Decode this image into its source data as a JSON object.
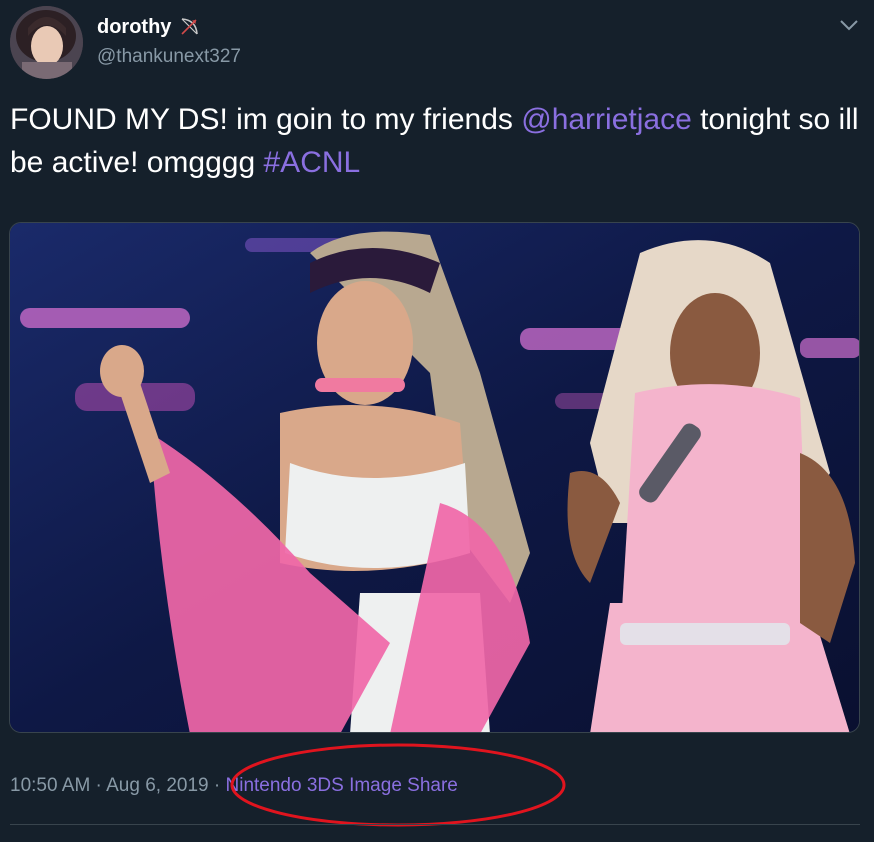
{
  "user": {
    "display_name": "dorothy",
    "handle": "@thankunext327",
    "name_emoji": "bow-and-arrow-icon"
  },
  "tweet": {
    "text_parts": {
      "t1": "FOUND MY DS! im goin to my friends ",
      "mention": "@harrietjace",
      "t2": " tonight so ill be active! omgggg ",
      "hashtag": "#ACNL"
    },
    "image_description": "concert photo of two performers on stage"
  },
  "meta": {
    "time": "10:50 AM",
    "separator1": " · ",
    "date": "Aug 6, 2019",
    "separator2": " · ",
    "source": "Nintendo 3DS Image Share"
  },
  "colors": {
    "background": "#15202b",
    "link": "#8a6fe0",
    "muted": "#8899a6",
    "annotation": "#e0141e"
  }
}
